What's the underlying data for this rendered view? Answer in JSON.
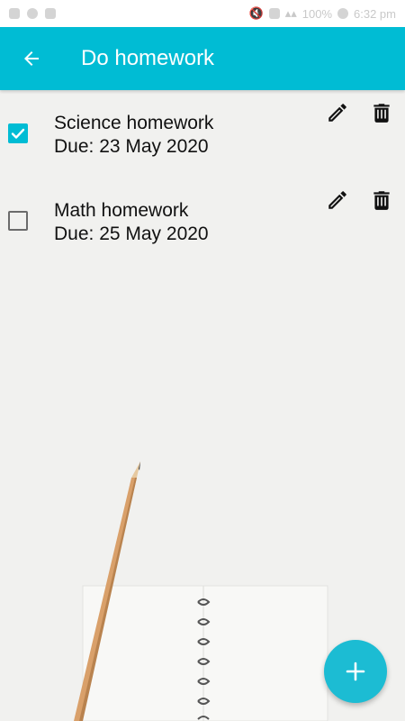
{
  "status_bar": {
    "icons": [
      "notification-icon",
      "chat-icon",
      "mail-icon",
      "mute-icon",
      "alarm-icon",
      "wifi-icon",
      "signal-icon",
      "battery-icon"
    ],
    "battery": "100%",
    "time": "6:32 pm"
  },
  "app_bar": {
    "title": "Do homework",
    "background_color": "#00bcd4"
  },
  "tasks": [
    {
      "title": "Science homework",
      "due": "Due: 23 May 2020",
      "checked": true
    },
    {
      "title": "Math homework",
      "due": "Due: 25 May 2020",
      "checked": false
    }
  ],
  "fab": {
    "icon": "plus-icon",
    "color": "#1cbcd3"
  },
  "colors": {
    "accent": "#00bcd4",
    "background": "#f1f1ef"
  }
}
